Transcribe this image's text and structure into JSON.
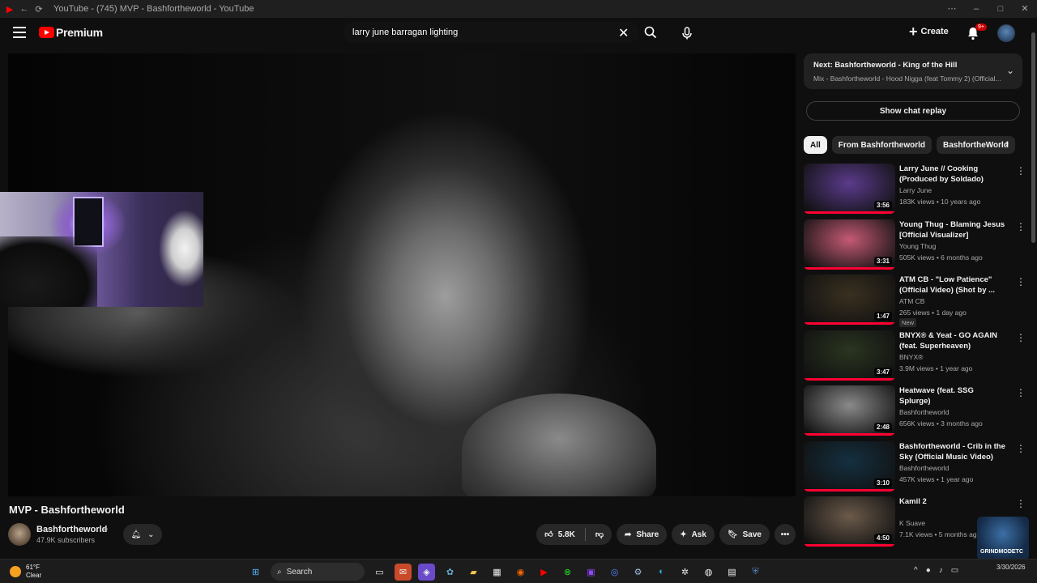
{
  "window": {
    "title": "YouTube - (745) MVP - Bashfortheworld - YouTube"
  },
  "masthead": {
    "logo_text": "Premium",
    "search_value": "larry june barragan lighting",
    "create_label": "Create",
    "notification_badge": "9+"
  },
  "video": {
    "title": "MVP - Bashfortheworld",
    "channel": "Bashfortheworld",
    "subscribers": "47.9K subscribers",
    "likes": "5.8K",
    "share_label": "Share",
    "ask_label": "Ask",
    "save_label": "Save"
  },
  "sidebar": {
    "up_next_prefix": "Next:",
    "up_next_title": "Bashfortheworld - King of the Hill",
    "up_next_sub": "Mix - Bashfortheworld - Hood Nigga (feat Tommy 2) (Official...",
    "chat_replay_label": "Show chat replay",
    "chips": [
      "All",
      "From Bashfortheworld",
      "BashfortheWorld"
    ],
    "recommendations": [
      {
        "title": "Larry June // Cooking (Produced by Soldado)",
        "channel": "Larry June",
        "meta": "183K views • 10 years ago",
        "duration": "3:56",
        "thumb_color": "#5b3b8c",
        "badge": ""
      },
      {
        "title": "Young Thug - Blaming Jesus [Official Visualizer]",
        "channel": "Young Thug",
        "meta": "505K views • 6 months ago",
        "duration": "3:31",
        "thumb_color": "#c45a74",
        "badge": ""
      },
      {
        "title": "ATM CB - \"Low Patience\" (Official Video) (Shot by ...",
        "channel": "ATM CB",
        "meta": "265 views • 1 day ago",
        "duration": "1:47",
        "thumb_color": "#3a3020",
        "badge": "New"
      },
      {
        "title": "BNYX® & Yeat - GO AGAIN (feat. Superheaven)",
        "channel": "BNYX®",
        "meta": "3.9M views • 1 year ago",
        "duration": "3:47",
        "thumb_color": "#2a3520",
        "badge": ""
      },
      {
        "title": "Heatwave (feat. SSG Splurge)",
        "channel": "Bashfortheworld",
        "meta": "656K views • 3 months ago",
        "duration": "2:48",
        "thumb_color": "#8a8a8a",
        "badge": ""
      },
      {
        "title": "Bashfortheworld - Crib in the Sky (Official Music Video)",
        "channel": "Bashfortheworld",
        "meta": "457K views • 1 year ago",
        "duration": "3:10",
        "thumb_color": "#143040",
        "badge": ""
      },
      {
        "title": "Kamil 2",
        "channel": "K Suave",
        "meta": "7.1K views • 5 months ago",
        "duration": "4:50",
        "thumb_color": "#6b5a4a",
        "badge": ""
      }
    ],
    "corner_logo_text": "GRINDMODETC"
  },
  "taskbar": {
    "temperature": "61°F",
    "condition": "Clear",
    "search_label": "Search",
    "time": "",
    "date": "3/30/2026"
  }
}
